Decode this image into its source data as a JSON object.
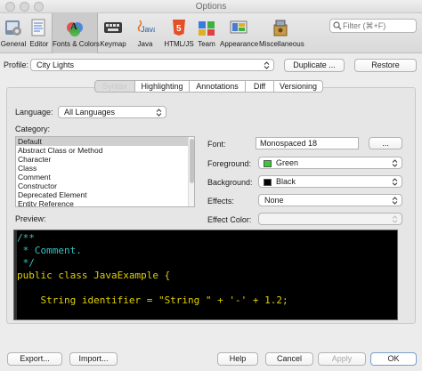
{
  "window": {
    "title": "Options"
  },
  "toolbar": {
    "items": [
      {
        "label": "General",
        "icon": "general-icon"
      },
      {
        "label": "Editor",
        "icon": "editor-icon"
      },
      {
        "label": "Fonts & Colors",
        "icon": "fonts-colors-icon",
        "active": true
      },
      {
        "label": "Keymap",
        "icon": "keymap-icon"
      },
      {
        "label": "Java",
        "icon": "java-icon"
      },
      {
        "label": "HTML/JS",
        "icon": "html5-icon"
      },
      {
        "label": "Team",
        "icon": "team-icon"
      },
      {
        "label": "Appearance",
        "icon": "appearance-icon"
      },
      {
        "label": "Miscellaneous",
        "icon": "miscellaneous-icon"
      }
    ],
    "filter_placeholder": "Filter (⌘+F)"
  },
  "profile": {
    "label": "Profile:",
    "value": "City Lights",
    "duplicate_label": "Duplicate ...",
    "restore_label": "Restore"
  },
  "tabs": [
    {
      "label": "Syntax",
      "active": true
    },
    {
      "label": "Highlighting"
    },
    {
      "label": "Annotations"
    },
    {
      "label": "Diff"
    },
    {
      "label": "Versioning"
    }
  ],
  "language": {
    "label": "Language:",
    "value": "All Languages"
  },
  "category": {
    "label": "Category:",
    "items": [
      "Default",
      "Abstract Class or Method",
      "Character",
      "Class",
      "Comment",
      "Constructor",
      "Deprecated Element",
      "Entity Reference"
    ],
    "selected_index": 0
  },
  "font": {
    "label": "Font:",
    "value": "Monospaced 18",
    "button_label": "..."
  },
  "foreground": {
    "label": "Foreground:",
    "value": "Green",
    "color": "#33cc33"
  },
  "background": {
    "label": "Background:",
    "value": "Black",
    "color": "#000000"
  },
  "effects": {
    "label": "Effects:",
    "value": "None"
  },
  "effect_color": {
    "label": "Effect Color:"
  },
  "preview": {
    "label": "Preview:",
    "lines": [
      {
        "text": "/**",
        "color": "#36c3c3"
      },
      {
        "text": " * Comment.",
        "color": "#36c3c3"
      },
      {
        "text": " */",
        "color": "#36c3c3"
      },
      {
        "text": "public class JavaExample {",
        "color": "#e0d000"
      },
      {
        "text": "",
        "color": "#e0d000"
      },
      {
        "text": "    String identifier = \"String \" + '-' + 1.2;",
        "color": "#e0d000"
      }
    ]
  },
  "footer": {
    "export_label": "Export...",
    "import_label": "Import...",
    "help_label": "Help",
    "cancel_label": "Cancel",
    "apply_label": "Apply",
    "ok_label": "OK"
  }
}
